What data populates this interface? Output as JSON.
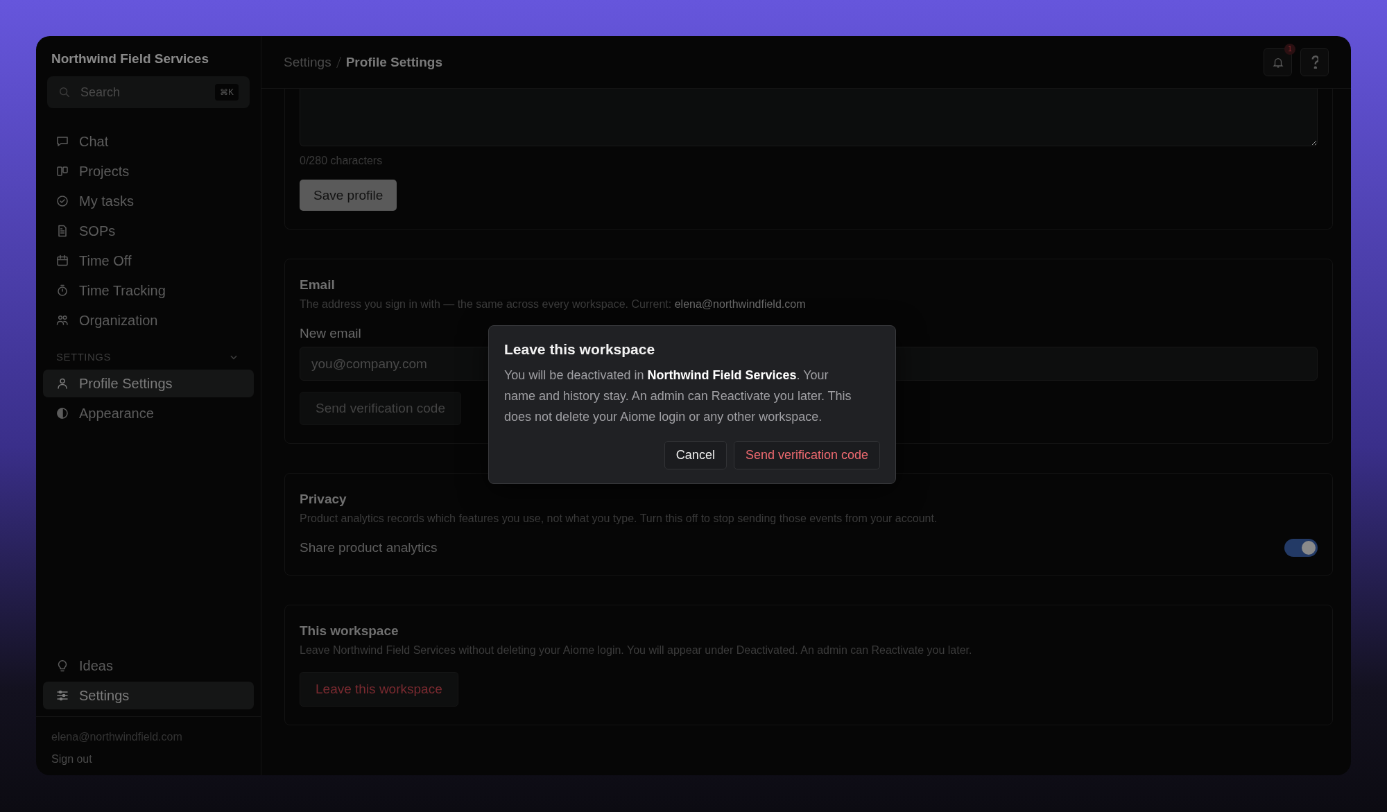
{
  "sidebar": {
    "workspace_name": "Northwind Field Services",
    "search": {
      "placeholder": "Search",
      "shortcut": "⌘K"
    },
    "nav_items": [
      {
        "label": "Chat",
        "kind": "chat",
        "selected": false
      },
      {
        "label": "Projects",
        "kind": "board",
        "selected": false
      },
      {
        "label": "My tasks",
        "kind": "check",
        "selected": false
      },
      {
        "label": "SOPs",
        "kind": "document",
        "selected": false
      },
      {
        "label": "Time Off",
        "kind": "calendar",
        "selected": false
      },
      {
        "label": "Time Tracking",
        "kind": "stopwatch",
        "selected": false
      },
      {
        "label": "Organization",
        "kind": "people",
        "selected": false
      }
    ],
    "settings_section": {
      "heading": "SETTINGS",
      "expanded": true,
      "items": [
        {
          "label": "Profile Settings",
          "kind": "person",
          "selected": true
        },
        {
          "label": "Appearance",
          "kind": "contrast",
          "selected": false
        }
      ]
    },
    "bottom_items": [
      {
        "label": "Ideas",
        "kind": "bulb",
        "selected": false
      },
      {
        "label": "Settings",
        "kind": "sliders",
        "selected": true
      }
    ],
    "user_email": "elena@northwindfield.com",
    "sign_out": "Sign out"
  },
  "topbar": {
    "breadcrumb": [
      "Settings",
      "Profile Settings"
    ],
    "notification_count": "1"
  },
  "profile_card": {
    "char_count": "0/280 characters",
    "save_button": "Save profile"
  },
  "email_card": {
    "title": "Email",
    "description": "The address you sign in with — the same across every workspace. Current:",
    "current_email": "elena@northwindfield.com",
    "field_label": "New email",
    "placeholder": "you@company.com",
    "send_button": "Send verification code"
  },
  "privacy_card": {
    "title": "Privacy",
    "description": "Product analytics records which features you use, not what you type. Turn this off to stop sending those events from your account.",
    "toggle_label": "Share product analytics",
    "on": true
  },
  "workspace_card": {
    "title": "This workspace",
    "description": "Leave Northwind Field Services without deleting your Aiome login. You will appear under Deactivated. An admin can Reactivate you later.",
    "leave_button": "Leave this workspace"
  },
  "modal": {
    "title": "Leave this workspace",
    "body": "You will be deactivated in **Northwind Field Services**. Your name and history stay. An admin can Reactivate you later. This does not delete your Aiome login or any other workspace.",
    "cancel_button": "Cancel",
    "confirm_button": "Send verification code"
  }
}
